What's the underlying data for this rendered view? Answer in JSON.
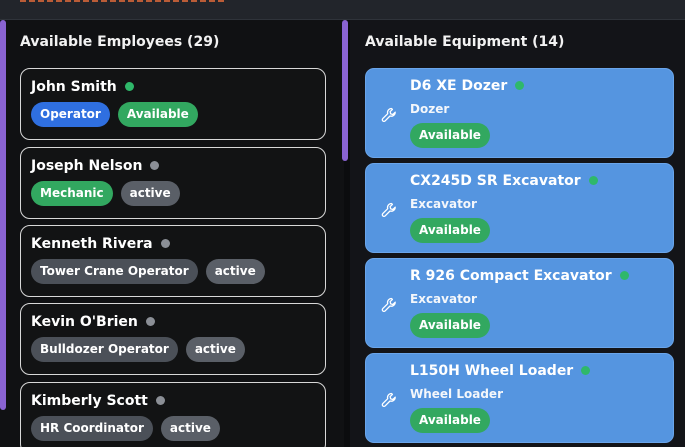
{
  "employees_panel": {
    "title": "Available Employees (29)",
    "employees": [
      {
        "name": "John Smith",
        "role": "Operator",
        "status": "Available"
      },
      {
        "name": "Joseph Nelson",
        "role": "Mechanic",
        "status": "active"
      },
      {
        "name": "Kenneth Rivera",
        "role": "Tower Crane Operator",
        "status": "active"
      },
      {
        "name": "Kevin O'Brien",
        "role": "Bulldozer Operator",
        "status": "active"
      },
      {
        "name": "Kimberly Scott",
        "role": "HR Coordinator",
        "status": "active"
      }
    ]
  },
  "equipment_panel": {
    "title": "Available Equipment (14)",
    "items": [
      {
        "name": "D6 XE Dozer",
        "type": "Dozer",
        "status": "Available",
        "icon": "wrench-icon"
      },
      {
        "name": "CX245D SR Excavator",
        "type": "Excavator",
        "status": "Available",
        "icon": "wrench-icon"
      },
      {
        "name": "R 926 Compact Excavator",
        "type": "Excavator",
        "status": "Available",
        "icon": "wrench-icon"
      },
      {
        "name": "L150H Wheel Loader",
        "type": "Wheel Loader",
        "status": "Available",
        "icon": "wrench-icon"
      }
    ]
  },
  "colors": {
    "accent": "#8a63d2",
    "available_green": "#32a860",
    "operator_blue": "#2f6fe0",
    "equipment_card": "#5595e0"
  }
}
